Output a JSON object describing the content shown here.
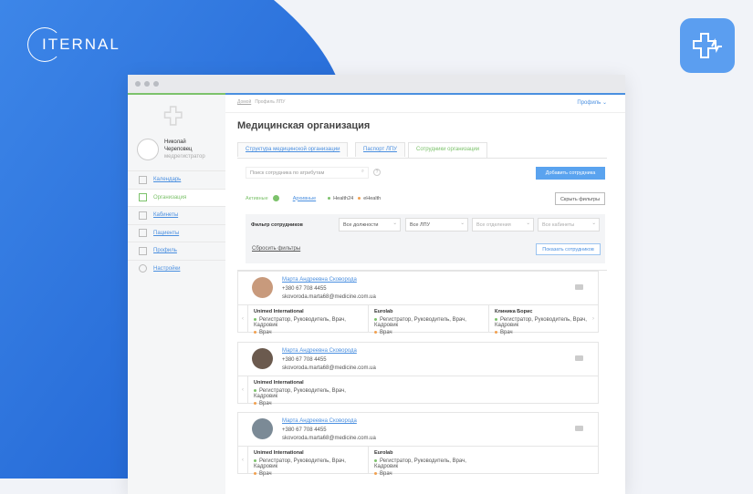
{
  "brand": {
    "name": "ITERNAL",
    "accent": "#3b82e6"
  },
  "window": {
    "breadcrumb": [
      "Домой",
      "Профиль ЛПУ"
    ],
    "profile_menu": "Профиль"
  },
  "user": {
    "name_line1": "Николай",
    "name_line2": "Череповец",
    "role": "медрегистратор"
  },
  "sidebar": {
    "items": [
      {
        "label": "Календарь",
        "icon": "calendar-icon"
      },
      {
        "label": "Организация",
        "icon": "organization-icon",
        "active": true
      },
      {
        "label": "Кабинеты",
        "icon": "cabinets-icon"
      },
      {
        "label": "Пациенты",
        "icon": "patients-icon"
      },
      {
        "label": "Профиль",
        "icon": "profile-icon"
      },
      {
        "label": "Настройки",
        "icon": "settings-icon"
      }
    ]
  },
  "page": {
    "title": "Медицинская организация",
    "tabs": [
      "Структура медицинской организации",
      "Паспорт ЛПУ",
      "Сотрудники организации"
    ],
    "search_placeholder": "Поиск сотрудника по атрибутам",
    "add_button": "Добавить сотрудника",
    "status": {
      "active": "Активные",
      "archive": "Архивные",
      "health24": "Health24",
      "ehealth": "eHealth"
    },
    "hide_filters": "Скрыть фильтры",
    "filter": {
      "label": "Фильтр сотрудников",
      "selects": [
        "Все должности",
        "Все ЛПУ",
        "Все отделения",
        "Все кабинеты"
      ],
      "reset": "Сбросить фильтры",
      "show": "Показать сотрудников"
    }
  },
  "employees": [
    {
      "name": "Марта Андреевна Сковорода",
      "phone": "+380 67 708 4455",
      "email": "skovoroda.marta68@medicine.com.ua",
      "orgs": [
        {
          "name": "Unimed International",
          "roles": "Регистратор, Руководитель, Врач, Кадровик",
          "role2": "Врач"
        },
        {
          "name": "Eurolab",
          "roles": "Регистратор, Руководитель, Врач, Кадровик",
          "role2": "Врач"
        },
        {
          "name": "Клиника Борис",
          "roles": "Регистратор, Руководитель, Врач, Кадровик",
          "role2": "Врач"
        }
      ]
    },
    {
      "name": "Марта Андреевна Сковорода",
      "phone": "+380 67 708 4455",
      "email": "skovoroda.marta68@medicine.com.ua",
      "orgs": [
        {
          "name": "Unimed International",
          "roles": "Регистратор, Руководитель, Врач, Кадровик",
          "role2": "Врач"
        }
      ]
    },
    {
      "name": "Марта Андреевна Сковорода",
      "phone": "+380 67 708 4455",
      "email": "skovoroda.marta68@medicine.com.ua",
      "orgs": [
        {
          "name": "Unimed International",
          "roles": "Регистратор, Руководитель, Врач, Кадровик",
          "role2": "Врач"
        },
        {
          "name": "Eurolab",
          "roles": "Регистратор, Руководитель, Врач, Кадровик",
          "role2": "Врач"
        }
      ]
    }
  ]
}
